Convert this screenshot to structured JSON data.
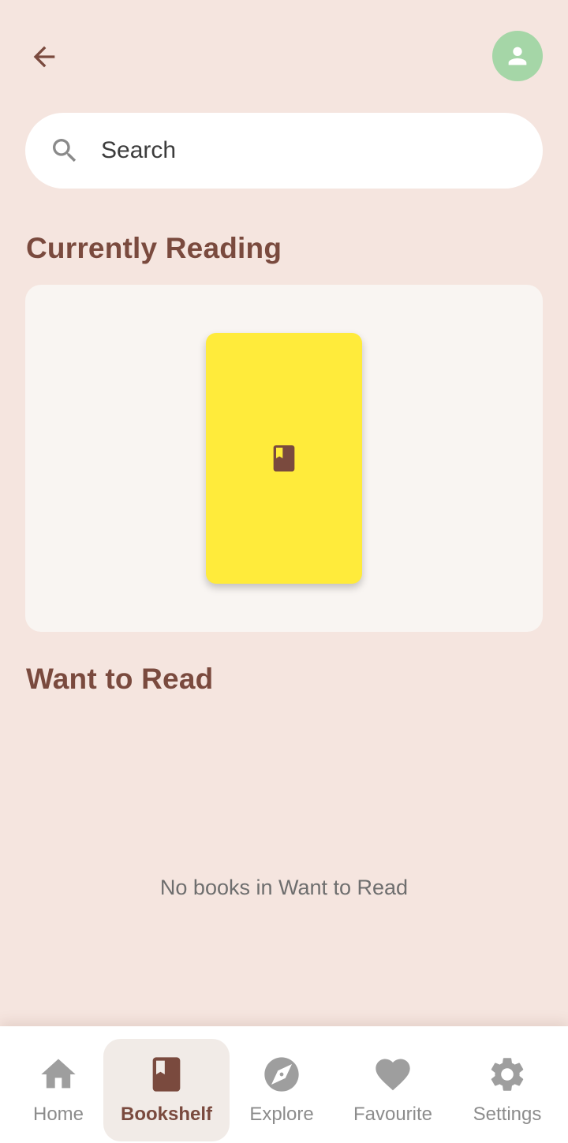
{
  "header": {
    "back_icon": "arrow-back-icon",
    "avatar_icon": "person-icon"
  },
  "search": {
    "placeholder": "Search",
    "value": ""
  },
  "sections": {
    "currently_reading": "Currently Reading",
    "want_to_read": "Want to Read"
  },
  "currently_reading_book": {
    "icon": "book-icon",
    "cover_color": "#ffeb3b"
  },
  "want_to_read_empty": "No books in Want to Read",
  "nav": {
    "items": [
      {
        "label": "Home",
        "icon": "home-icon",
        "active": false
      },
      {
        "label": "Bookshelf",
        "icon": "book-icon",
        "active": true
      },
      {
        "label": "Explore",
        "icon": "compass-icon",
        "active": false
      },
      {
        "label": "Favourite",
        "icon": "heart-icon",
        "active": false
      },
      {
        "label": "Settings",
        "icon": "gear-icon",
        "active": false
      }
    ]
  },
  "colors": {
    "background": "#f5e5df",
    "accent": "#7a4a3e",
    "avatar": "#a5d6a7",
    "inactive": "#9e9e9e"
  }
}
